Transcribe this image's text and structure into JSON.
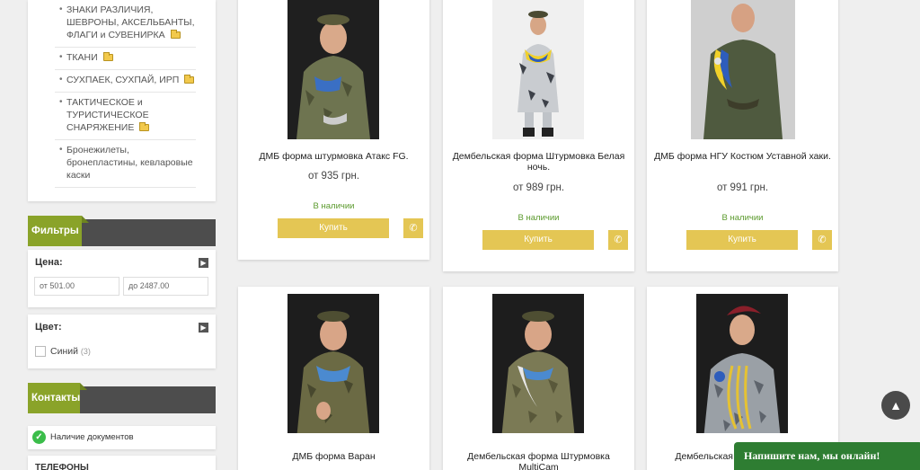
{
  "categories": [
    {
      "label": "ЗНАКИ РАЗЛИЧИЯ, ШЕВРОНЫ, АКСЕЛЬБАНТЫ, ФЛАГИ и СУВЕНИРКА",
      "folder": true
    },
    {
      "label": "ТКАНИ",
      "folder": true
    },
    {
      "label": "СУХПАЕК, СУХПАЙ, ИРП",
      "folder": true
    },
    {
      "label": "ТАКТИЧЕСКОЕ и ТУРИСТИЧЕСКОЕ СНАРЯЖЕНИЕ",
      "folder": true
    },
    {
      "label": "Бронежилеты, бронепластины, кевларовые каски",
      "folder": false
    }
  ],
  "filters": {
    "heading": "Фильтры",
    "price_title": "Цена:",
    "price_from": "от 501.00",
    "price_to": "до 2487.00",
    "color_title": "Цвет:",
    "color_option": "Синий",
    "color_count": "(3)"
  },
  "contacts": {
    "heading": "Контакты",
    "docs": "Наличие документов",
    "phones_title": "ТЕЛЕФОНЫ"
  },
  "products": [
    {
      "title": "ДМБ форма штурмовка Атакс FG.",
      "price": "от 935 грн.",
      "stock": "В наличии",
      "buy": "Купить"
    },
    {
      "title": "Дембельская форма Штурмовка Белая ночь.",
      "price": "от 989 грн.",
      "stock": "В наличии",
      "buy": "Купить"
    },
    {
      "title": "ДМБ форма НГУ Костюм Уставной хаки.",
      "price": "от 991 грн.",
      "stock": "В наличии",
      "buy": "Купить"
    },
    {
      "title": "ДМБ форма Варан"
    },
    {
      "title": "Дембельская форма Штурмовка MultiCam"
    },
    {
      "title": "Дембельская форма Флекбарк"
    }
  ],
  "chat": {
    "label": "Напишите нам, мы онлайн!"
  },
  "icons": {
    "phone": "phone-icon",
    "arrow_up": "arrow-up-icon",
    "check": "check-icon",
    "folder": "folder-icon",
    "arrow_right": "arrow-right-icon"
  },
  "colors": {
    "accent_green": "#8aa329",
    "buy_yellow": "#e4c654",
    "stock_green": "#5b9a2d",
    "chat_green": "#2e7d32",
    "header_dark": "#4d4d4d"
  }
}
